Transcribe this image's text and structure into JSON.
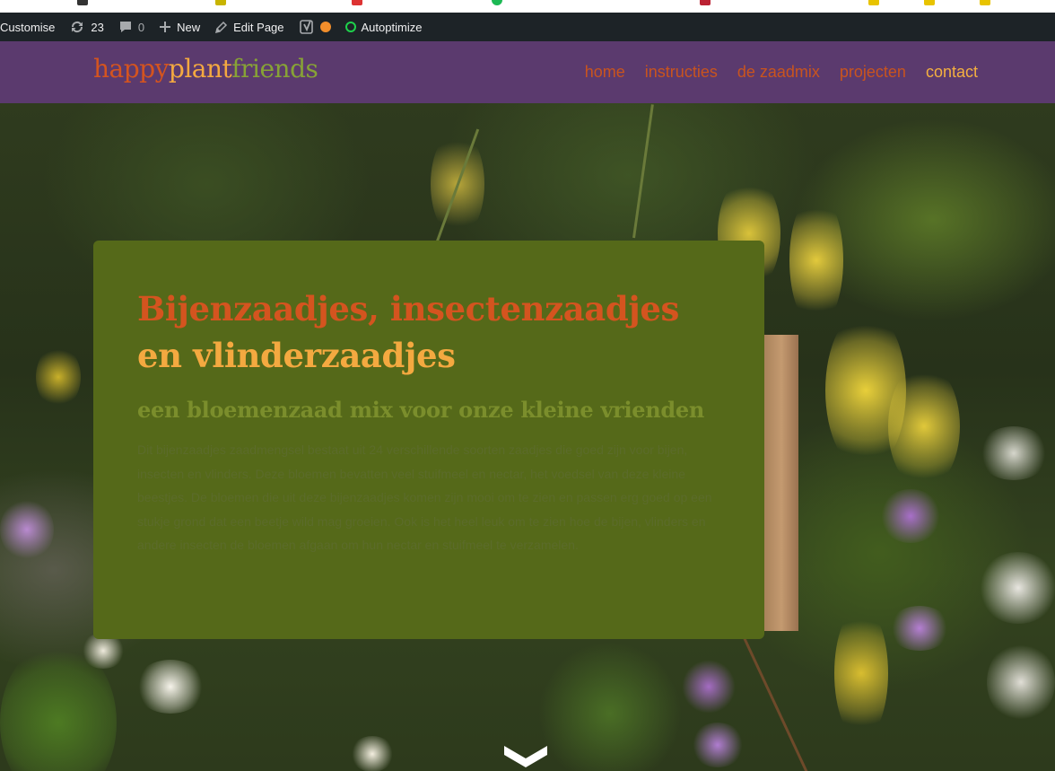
{
  "adminbar": {
    "customise": "Customise",
    "updates_count": "23",
    "comments_count": "0",
    "new_label": "New",
    "edit_page": "Edit Page",
    "autoptimize": "Autoptimize"
  },
  "site": {
    "logo": {
      "part1": "happy",
      "part2": "plant",
      "part3": "friends"
    },
    "nav": [
      {
        "label": "home"
      },
      {
        "label": "instructies"
      },
      {
        "label": "de zaadmix"
      },
      {
        "label": "projecten"
      },
      {
        "label": "contact",
        "active": true
      }
    ]
  },
  "hero": {
    "title_line1": "Bijenzaadjes, insectenzaadjes",
    "title_line2": "en vlinderzaadjes",
    "subtitle": "een bloemenzaad mix voor onze kleine vrienden",
    "body": "Dit bijenzaadjes zaadmengsel bestaat uit 24 verschillende soorten zaadjes die goed zijn voor bijen, insecten en vlinders. Deze bloemen bevatten veel stuifmeel en nectar, het voedsel van deze kleine beestjes. De bloemen die uit deze bijenzaadjes komen zijn mooi om te zien en passen erg goed op een stukje grond dat een beetje wild mag groeien. Ook is het heel leuk om te zien hoe de bijen, vlinders en andere insecten de bloemen afgaan om hun nectar en stuifmeel te verzamelen."
  },
  "colors": {
    "admin_bg": "#1d2327",
    "header_bg": "#5b3a6e",
    "logo_orange": "#d4541f",
    "logo_yellow": "#f4a940",
    "logo_green": "#87a236",
    "card_bg": "#556919",
    "nav_active": "#f4b040"
  }
}
